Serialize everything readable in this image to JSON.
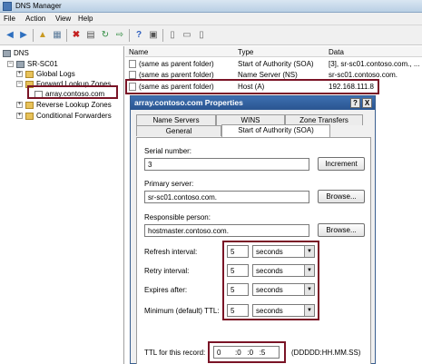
{
  "window": {
    "title": "DNS Manager"
  },
  "menu": [
    "File",
    "Action",
    "View",
    "Help"
  ],
  "toolbar": {
    "icons": [
      "back-arrow-icon",
      "forward-arrow-icon",
      "up-folder-icon",
      "show-hide-tree-icon",
      "delete-icon",
      "properties-icon",
      "refresh-icon",
      "export-icon",
      "help-icon",
      "console-icon",
      "host-icon",
      "zone-icon",
      "document-icon"
    ]
  },
  "tree": {
    "root": "DNS",
    "server": "SR-SC01",
    "items": [
      "Global Logs",
      "Forward Lookup Zones",
      "array.contoso.com",
      "Reverse Lookup Zones",
      "Conditional Forwarders"
    ]
  },
  "list": {
    "columns": [
      "Name",
      "Type",
      "Data"
    ],
    "rows": [
      {
        "name": "(same as parent folder)",
        "type": "Start of Authority (SOA)",
        "data": "[3], sr-sc01.contoso.com., ..."
      },
      {
        "name": "(same as parent folder)",
        "type": "Name Server (NS)",
        "data": "sr-sc01.contoso.com."
      },
      {
        "name": "(same as parent folder)",
        "type": "Host (A)",
        "data": "192.168.111.8"
      }
    ]
  },
  "dialog": {
    "title": "array.contoso.com Properties",
    "help_btn": "?",
    "close_btn": "X",
    "tabs_top": [
      "Name Servers",
      "WINS",
      "Zone Transfers"
    ],
    "tabs_bottom": [
      "General",
      "Start of Authority (SOA)"
    ],
    "serial": {
      "label": "Serial number:",
      "value": "3",
      "button": "Increment"
    },
    "primary": {
      "label": "Primary server:",
      "value": "sr-sc01.contoso.com.",
      "button": "Browse..."
    },
    "responsible": {
      "label": "Responsible person:",
      "value": "hostmaster.contoso.com.",
      "button": "Browse..."
    },
    "intervals": [
      {
        "label": "Refresh interval:",
        "value": "5",
        "unit": "seconds"
      },
      {
        "label": "Retry interval:",
        "value": "5",
        "unit": "seconds"
      },
      {
        "label": "Expires after:",
        "value": "5",
        "unit": "seconds"
      },
      {
        "label": "Minimum (default) TTL:",
        "value": "5",
        "unit": "seconds"
      }
    ],
    "ttl": {
      "label": "TTL for this record:",
      "value": "0       :0   :0   :5",
      "format": "(DDDDD:HH.MM.SS)"
    }
  }
}
